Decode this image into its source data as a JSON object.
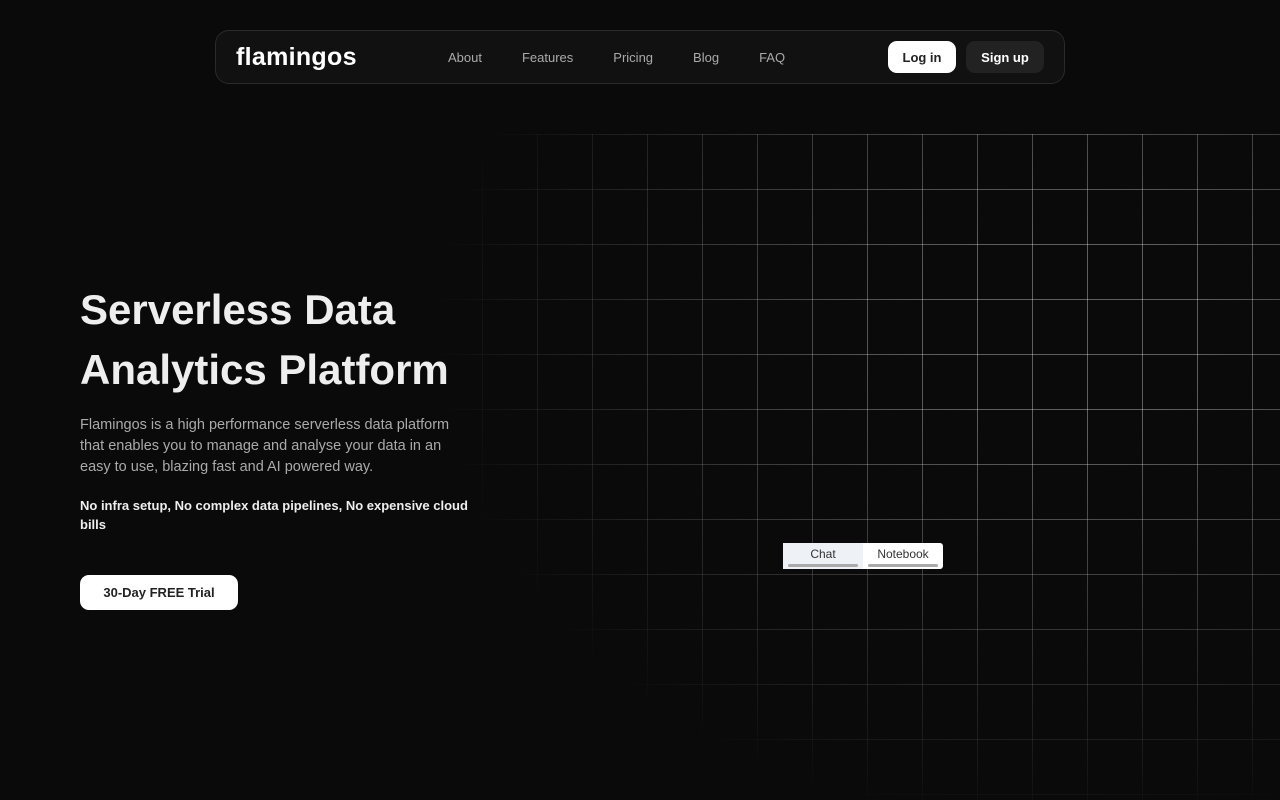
{
  "nav": {
    "logo": "flamingos",
    "links": [
      "About",
      "Features",
      "Pricing",
      "Blog",
      "FAQ"
    ],
    "login": "Log in",
    "signup": "Sign up"
  },
  "hero": {
    "title": "Serverless Data Analytics Platform",
    "description": "Flamingos is a high performance serverless data platform that enables you to manage and analyse your data in an easy to use, blazing fast and AI powered way.",
    "tagline": "No infra setup, No complex data pipelines, No expensive cloud bills",
    "cta": "30-Day FREE Trial"
  },
  "demo": {
    "tabs": [
      "Chat",
      "Notebook"
    ]
  }
}
